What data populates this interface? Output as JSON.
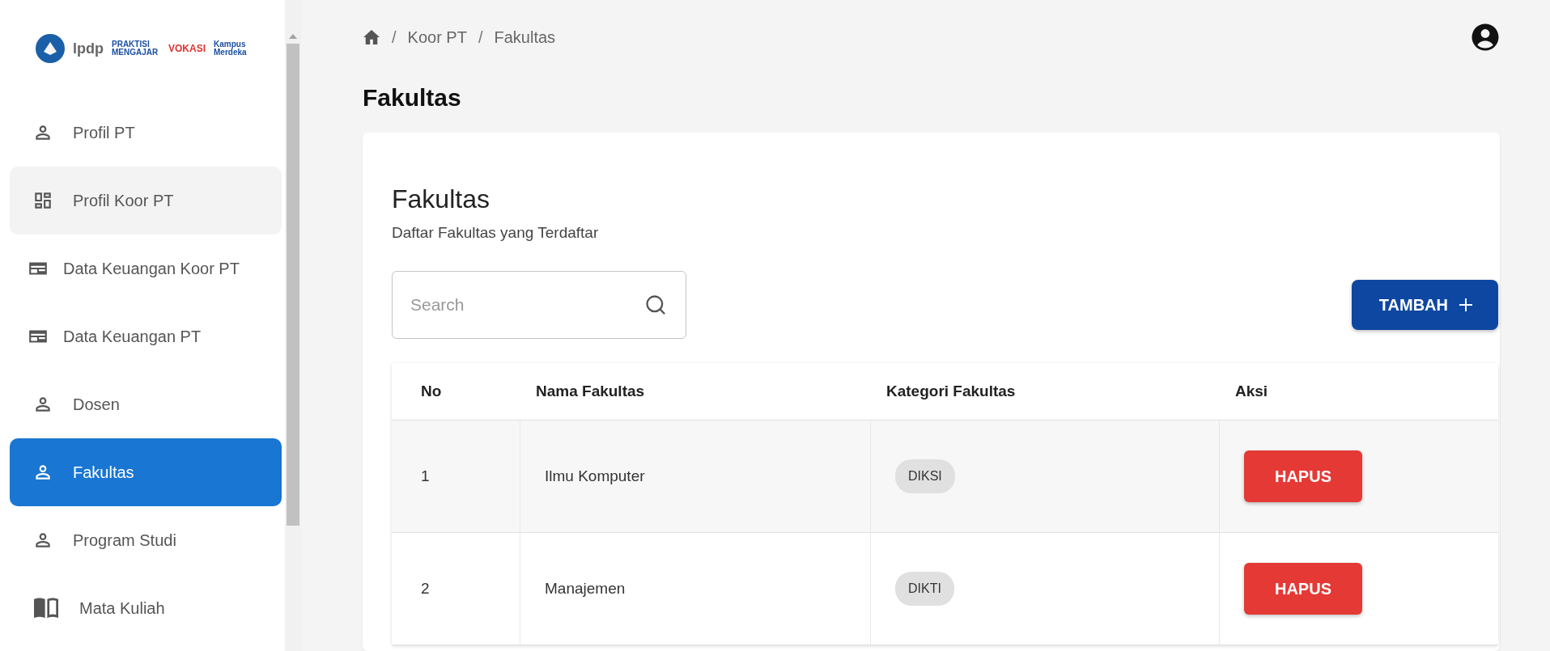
{
  "sidebar": {
    "logos": [
      "lpdp",
      "PRAKTISI MENGAJAR",
      "VOKASI",
      "Kampus Merdeka"
    ],
    "items": [
      {
        "label": "Profil PT",
        "selected": false,
        "hovered": false
      },
      {
        "label": "Profil Koor PT",
        "selected": false,
        "hovered": true
      },
      {
        "label": "Data Keuangan Koor PT",
        "selected": false,
        "hovered": false
      },
      {
        "label": "Data Keuangan PT",
        "selected": false,
        "hovered": false
      },
      {
        "label": "Dosen",
        "selected": false,
        "hovered": false
      },
      {
        "label": "Fakultas",
        "selected": true,
        "hovered": false
      },
      {
        "label": "Program Studi",
        "selected": false,
        "hovered": false
      },
      {
        "label": "Mata Kuliah",
        "selected": false,
        "hovered": false
      }
    ]
  },
  "breadcrumb": {
    "separator": "/",
    "items": [
      "Koor PT",
      "Fakultas"
    ]
  },
  "page_title": "Fakultas",
  "card": {
    "title": "Fakultas",
    "subtitle": "Daftar Fakultas yang Terdaftar",
    "search": {
      "placeholder": "Search"
    },
    "add_button": "TAMBAH",
    "table": {
      "columns": [
        "No",
        "Nama Fakultas",
        "Kategori Fakultas",
        "Aksi"
      ],
      "rows": [
        {
          "no": "1",
          "name": "Ilmu Komputer",
          "category": "DIKSI",
          "action": "HAPUS"
        },
        {
          "no": "2",
          "name": "Manajemen",
          "category": "DIKTI",
          "action": "HAPUS"
        }
      ]
    }
  }
}
